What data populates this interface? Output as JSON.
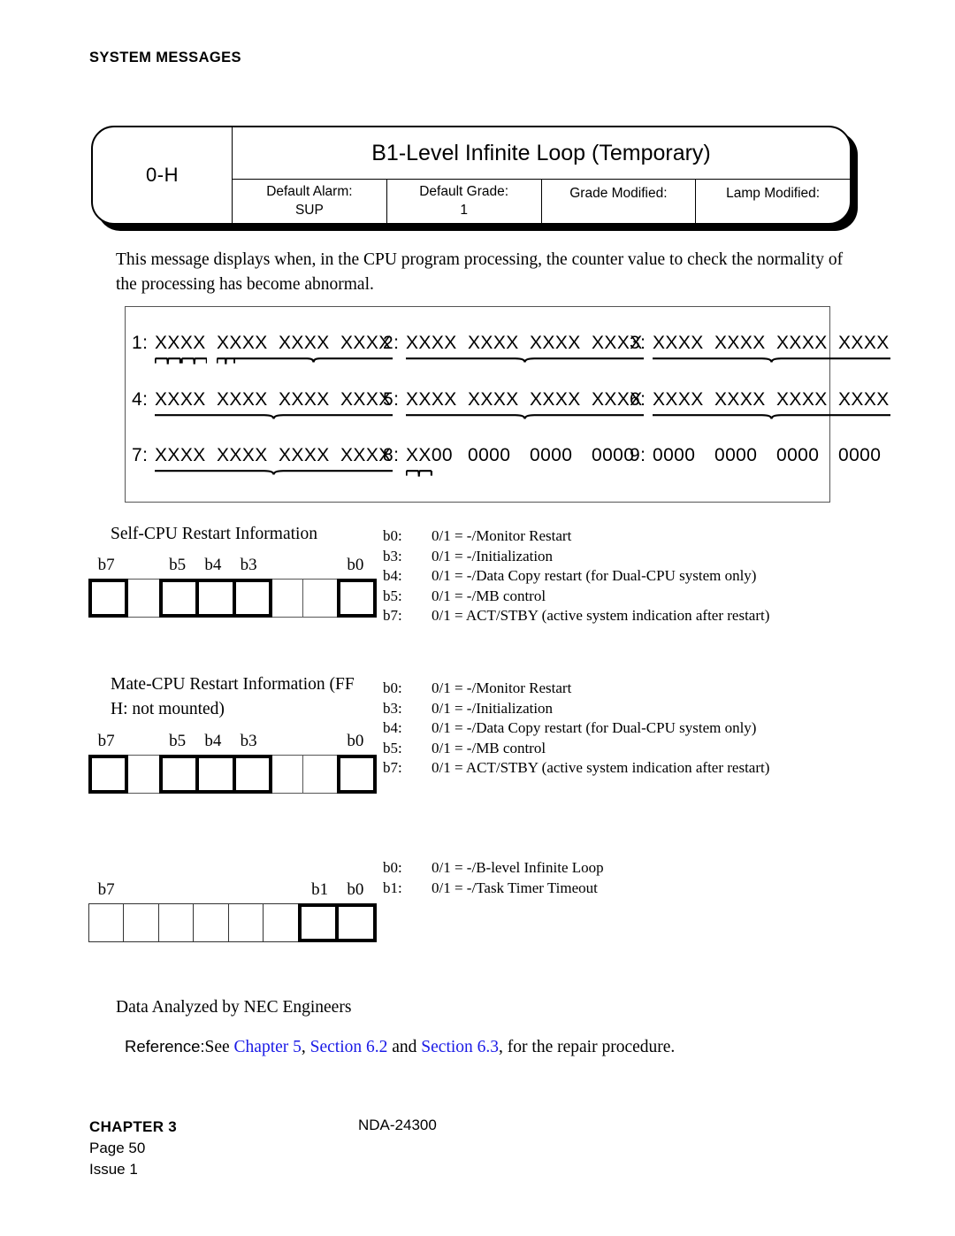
{
  "running_head": "SYSTEM MESSAGES",
  "card": {
    "code": "0-H",
    "title": "B1-Level Infinite Loop (Temporary)",
    "attributes": [
      {
        "label": "Default Alarm:",
        "value": "SUP"
      },
      {
        "label": "Default Grade:",
        "value": "1"
      },
      {
        "label": "Grade Modified:",
        "value": ""
      },
      {
        "label": "Lamp Modified:",
        "value": ""
      }
    ]
  },
  "description": "This message displays when, in the CPU program processing, the counter value to check the normality of the processing has become abnormal.",
  "data_grid": {
    "rows": [
      [
        {
          "index": "1:",
          "groups": [
            "XXXX",
            "XXXX",
            "XXXX",
            "XXXX"
          ]
        },
        {
          "index": "2:",
          "groups": [
            "XXXX",
            "XXXX",
            "XXXX",
            "XXXX"
          ]
        },
        {
          "index": "3:",
          "groups": [
            "XXXX",
            "XXXX",
            "XXXX",
            "XXXX"
          ]
        }
      ],
      [
        {
          "index": "4:",
          "groups": [
            "XXXX",
            "XXXX",
            "XXXX",
            "XXXX"
          ]
        },
        {
          "index": "5:",
          "groups": [
            "XXXX",
            "XXXX",
            "XXXX",
            "XXXX"
          ]
        },
        {
          "index": "6:",
          "groups": [
            "XXXX",
            "XXXX",
            "XXXX",
            "XXXX"
          ]
        }
      ],
      [
        {
          "index": "7:",
          "groups": [
            "XXXX",
            "XXXX",
            "XXXX",
            "XXXX"
          ]
        },
        {
          "index": "8:",
          "groups": [
            "XX00",
            "0000",
            "0000",
            "0000"
          ]
        },
        {
          "index": "9:",
          "groups": [
            "0000",
            "0000",
            "0000",
            "0000"
          ]
        }
      ]
    ]
  },
  "bitfields": [
    {
      "title": "Self-CPU Restart Information",
      "labels": [
        {
          "name": "b7",
          "bit": 7
        },
        {
          "name": "b5",
          "bit": 5
        },
        {
          "name": "b4",
          "bit": 4
        },
        {
          "name": "b3",
          "bit": 3
        },
        {
          "name": "b0",
          "bit": 0
        }
      ],
      "highlighted_bits": [
        7,
        5,
        4,
        3,
        0
      ],
      "legend": [
        {
          "bit": "b0:",
          "text": "0/1 = -/Monitor Restart"
        },
        {
          "bit": "b3:",
          "text": "0/1 = -/Initialization"
        },
        {
          "bit": "b4:",
          "text": "0/1 = -/Data Copy restart (for Dual-CPU system only)"
        },
        {
          "bit": "b5:",
          "text": "0/1 = -/MB control"
        },
        {
          "bit": "b7:",
          "text": "0/1 = ACT/STBY (active system indication after restart)"
        }
      ]
    },
    {
      "title": "Mate-CPU Restart Information (FF\n  H: not mounted)",
      "labels": [
        {
          "name": "b7",
          "bit": 7
        },
        {
          "name": "b5",
          "bit": 5
        },
        {
          "name": "b4",
          "bit": 4
        },
        {
          "name": "b3",
          "bit": 3
        },
        {
          "name": "b0",
          "bit": 0
        }
      ],
      "highlighted_bits": [
        7,
        5,
        4,
        3,
        0
      ],
      "legend": [
        {
          "bit": "b0:",
          "text": "0/1 = -/Monitor Restart"
        },
        {
          "bit": "b3:",
          "text": "0/1 = -/Initialization"
        },
        {
          "bit": "b4:",
          "text": "0/1 = -/Data Copy restart (for Dual-CPU system only)"
        },
        {
          "bit": "b5:",
          "text": "0/1 = -/MB control"
        },
        {
          "bit": "b7:",
          "text": "0/1 = ACT/STBY (active system indication after restart)"
        }
      ]
    },
    {
      "title": "",
      "labels": [
        {
          "name": "b7",
          "bit": 7
        },
        {
          "name": "b1",
          "bit": 1
        },
        {
          "name": "b0",
          "bit": 0
        }
      ],
      "highlighted_bits": [
        1,
        0
      ],
      "legend": [
        {
          "bit": "b0:",
          "text": "0/1 = -/B-level Infinite Loop"
        },
        {
          "bit": "b1:",
          "text": "0/1 = -/Task Timer Timeout"
        }
      ]
    }
  ],
  "analyzed_by": "Data Analyzed by NEC Engineers",
  "reference": {
    "label": "Reference:",
    "pre": "See ",
    "link1": "Chapter 5",
    "sep1": ", ",
    "link2": "Section 6.2",
    "sep2": " and ",
    "link3": "Section 6.3",
    "post": ", for the repair procedure.",
    "link_color": "#1a1ae6"
  },
  "footer": {
    "chapter": "CHAPTER 3",
    "page": "Page 50",
    "issue": "Issue 1",
    "document": "NDA-24300"
  }
}
